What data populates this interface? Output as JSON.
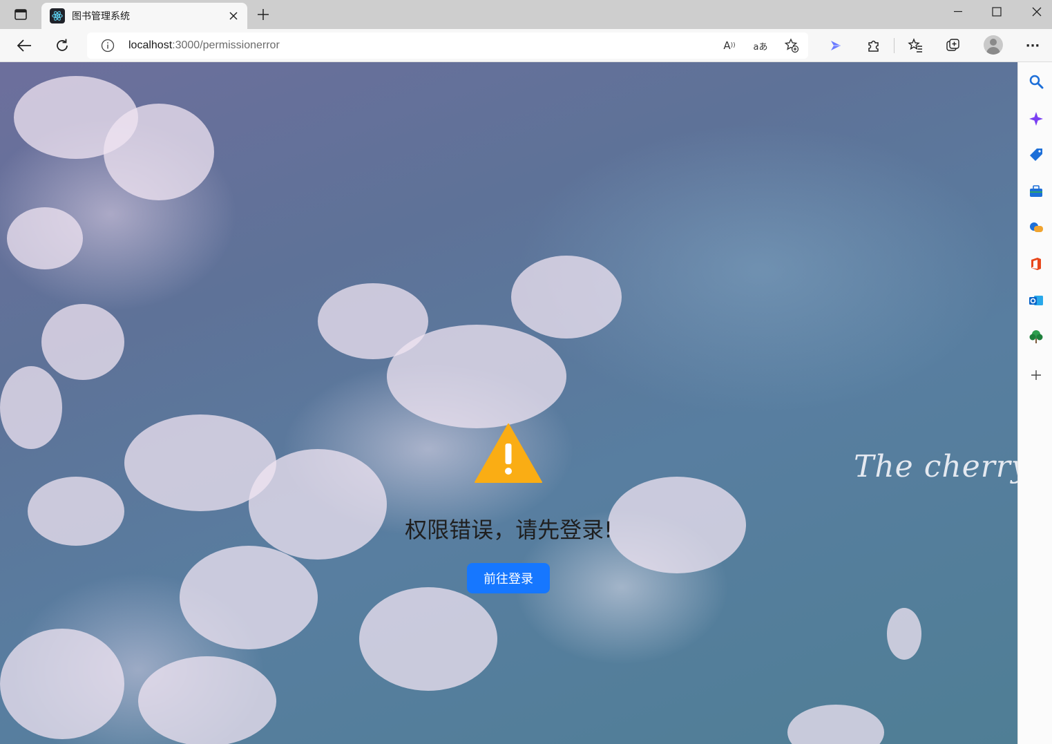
{
  "browser": {
    "tab_title": "图书管理系统",
    "url_host": "localhost",
    "url_rest": ":3000/permissionerror",
    "icons": {
      "tab_actions": "tab-actions-icon",
      "favicon": "react-icon",
      "close": "close-icon",
      "new_tab": "plus-icon",
      "back": "back-arrow-icon",
      "refresh": "refresh-icon",
      "info": "info-icon",
      "read_aloud": "read-aloud-icon",
      "translate": "translate-icon",
      "add_favorite": "add-favorite-icon",
      "extension_blue": "extension-icon",
      "extensions": "puzzle-icon",
      "favorites": "favorites-icon",
      "collections": "collections-icon",
      "profile": "profile-icon",
      "more": "more-icon"
    },
    "read_aloud_glyph": "A",
    "translate_glyph": "aあ",
    "more_glyph": "···"
  },
  "page": {
    "message": "权限错误，请先登录!",
    "login_button": "前往登录",
    "background_script": "The cherry",
    "warning_color": "#faad14",
    "button_color": "#1677ff"
  },
  "sidebar": {
    "items": [
      "search-icon",
      "copilot-icon",
      "shopping-icon",
      "tools-icon",
      "games-icon",
      "office-icon",
      "outlook-icon",
      "tree-icon",
      "add-icon"
    ]
  }
}
